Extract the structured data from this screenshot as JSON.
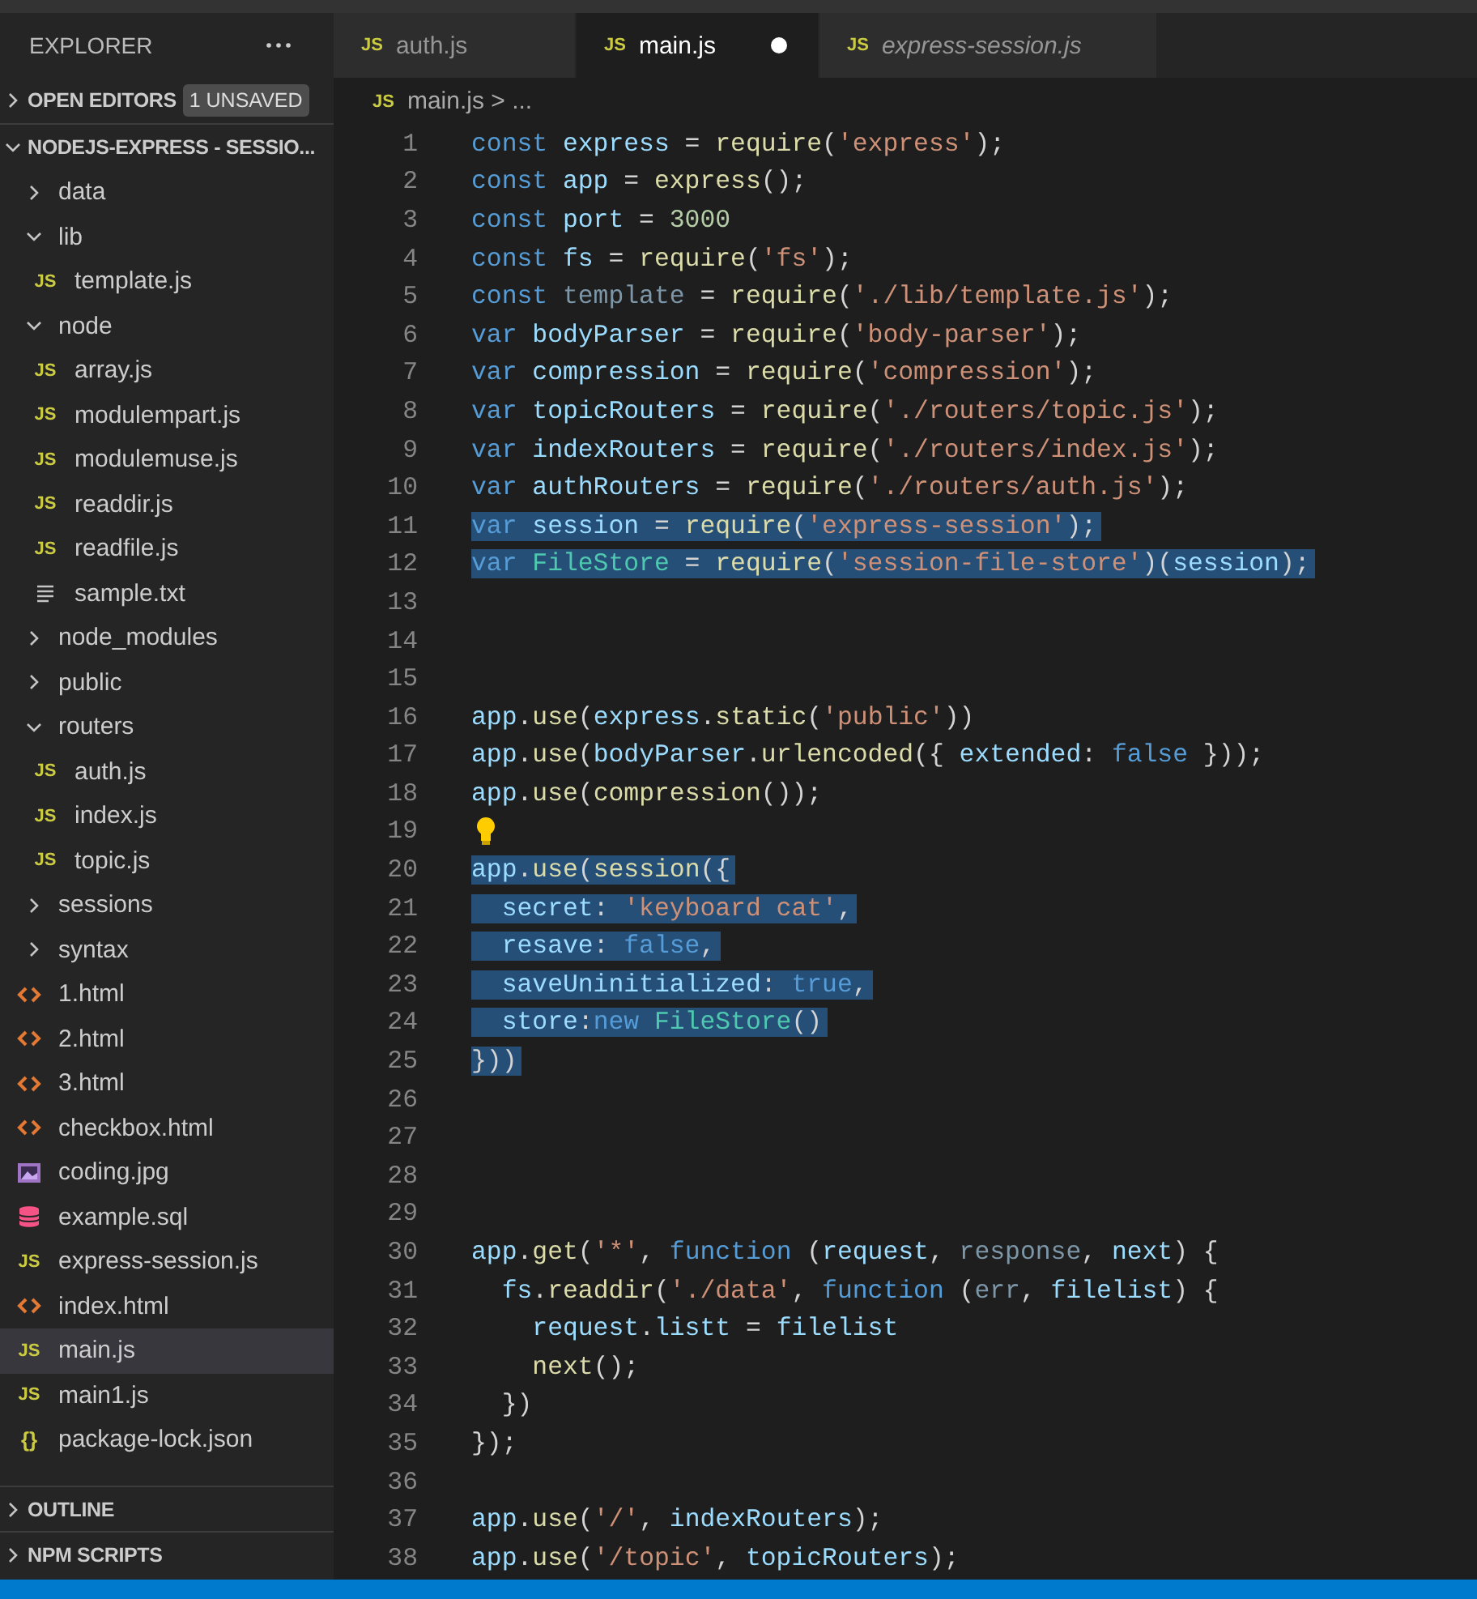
{
  "explorer": {
    "title": "EXPLORER"
  },
  "open_editors": {
    "label": "OPEN EDITORS",
    "badge": "1 UNSAVED",
    "expanded": false
  },
  "folder": {
    "label": "NODEJS-EXPRESS - SESSIO...",
    "expanded": true,
    "items": [
      {
        "label": "data",
        "kind": "folder",
        "expanded": false,
        "selected": false
      },
      {
        "label": "lib",
        "kind": "folder",
        "expanded": true,
        "selected": false,
        "children": [
          {
            "label": "template.js",
            "kind": "js",
            "icon_text": "JS",
            "selected": false
          }
        ]
      },
      {
        "label": "node",
        "kind": "folder",
        "expanded": true,
        "selected": false,
        "children": [
          {
            "label": "array.js",
            "kind": "js",
            "icon_text": "JS",
            "selected": false
          },
          {
            "label": "modulempart.js",
            "kind": "js",
            "icon_text": "JS",
            "selected": false
          },
          {
            "label": "modulemuse.js",
            "kind": "js",
            "icon_text": "JS",
            "selected": false
          },
          {
            "label": "readdir.js",
            "kind": "js",
            "icon_text": "JS",
            "selected": false
          },
          {
            "label": "readfile.js",
            "kind": "js",
            "icon_text": "JS",
            "selected": false
          },
          {
            "label": "sample.txt",
            "kind": "txt",
            "selected": false
          }
        ]
      },
      {
        "label": "node_modules",
        "kind": "folder",
        "expanded": false,
        "selected": false
      },
      {
        "label": "public",
        "kind": "folder",
        "expanded": false,
        "selected": false
      },
      {
        "label": "routers",
        "kind": "folder",
        "expanded": true,
        "selected": false,
        "children": [
          {
            "label": "auth.js",
            "kind": "js",
            "icon_text": "JS",
            "selected": false
          },
          {
            "label": "index.js",
            "kind": "js",
            "icon_text": "JS",
            "selected": false
          },
          {
            "label": "topic.js",
            "kind": "js",
            "icon_text": "JS",
            "selected": false
          }
        ]
      },
      {
        "label": "sessions",
        "kind": "folder",
        "expanded": false,
        "selected": false
      },
      {
        "label": "syntax",
        "kind": "folder",
        "expanded": false,
        "selected": false
      },
      {
        "label": "1.html",
        "kind": "html",
        "selected": false
      },
      {
        "label": "2.html",
        "kind": "html",
        "selected": false
      },
      {
        "label": "3.html",
        "kind": "html",
        "selected": false
      },
      {
        "label": "checkbox.html",
        "kind": "html",
        "selected": false
      },
      {
        "label": "coding.jpg",
        "kind": "image",
        "selected": false
      },
      {
        "label": "example.sql",
        "kind": "db",
        "selected": false
      },
      {
        "label": "express-session.js",
        "kind": "js",
        "icon_text": "JS",
        "selected": false
      },
      {
        "label": "index.html",
        "kind": "html",
        "selected": false
      },
      {
        "label": "main.js",
        "kind": "js",
        "icon_text": "JS",
        "selected": true
      },
      {
        "label": "main1.js",
        "kind": "js",
        "icon_text": "JS",
        "selected": false
      },
      {
        "label": "package-lock.json",
        "kind": "json",
        "icon_text": "{}",
        "selected": false
      }
    ]
  },
  "outline": {
    "label": "OUTLINE",
    "expanded": false
  },
  "npm_scripts": {
    "label": "NPM SCRIPTS",
    "expanded": false
  },
  "tabs": [
    {
      "label": "auth.js",
      "icon_text": "JS",
      "selected": false,
      "modified": false,
      "preview": false
    },
    {
      "label": "main.js",
      "icon_text": "JS",
      "selected": true,
      "modified": true,
      "preview": false
    },
    {
      "label": "express-session.js",
      "icon_text": "JS",
      "selected": false,
      "modified": false,
      "preview": true
    }
  ],
  "breadcrumb": {
    "icon_text": "JS",
    "path": "main.js > ..."
  },
  "lines": [
    {
      "number": "1",
      "selected": false,
      "tokens": [
        {
          "kind": "k",
          "text": "const "
        },
        {
          "kind": "v",
          "text": "express"
        },
        {
          "kind": "p",
          "text": " = "
        },
        {
          "kind": "f",
          "text": "require"
        },
        {
          "kind": "p",
          "text": "("
        },
        {
          "kind": "s",
          "text": "'express'"
        },
        {
          "kind": "p",
          "text": ");"
        }
      ]
    },
    {
      "number": "2",
      "selected": false,
      "tokens": [
        {
          "kind": "k",
          "text": "const "
        },
        {
          "kind": "v",
          "text": "app"
        },
        {
          "kind": "p",
          "text": " = "
        },
        {
          "kind": "f",
          "text": "express"
        },
        {
          "kind": "p",
          "text": "();"
        }
      ]
    },
    {
      "number": "3",
      "selected": false,
      "tokens": [
        {
          "kind": "k",
          "text": "const "
        },
        {
          "kind": "v",
          "text": "port"
        },
        {
          "kind": "p",
          "text": " = "
        },
        {
          "kind": "n",
          "text": "3000"
        }
      ]
    },
    {
      "number": "4",
      "selected": false,
      "tokens": [
        {
          "kind": "k",
          "text": "const "
        },
        {
          "kind": "v",
          "text": "fs"
        },
        {
          "kind": "p",
          "text": " = "
        },
        {
          "kind": "f",
          "text": "require"
        },
        {
          "kind": "p",
          "text": "("
        },
        {
          "kind": "s",
          "text": "'fs'"
        },
        {
          "kind": "p",
          "text": ");"
        }
      ]
    },
    {
      "number": "5",
      "selected": false,
      "tokens": [
        {
          "kind": "k",
          "text": "const "
        },
        {
          "kind": "u",
          "text": "template"
        },
        {
          "kind": "p",
          "text": " = "
        },
        {
          "kind": "f",
          "text": "require"
        },
        {
          "kind": "p",
          "text": "("
        },
        {
          "kind": "s",
          "text": "'./lib/template.js'"
        },
        {
          "kind": "p",
          "text": ");"
        }
      ]
    },
    {
      "number": "6",
      "selected": false,
      "tokens": [
        {
          "kind": "k",
          "text": "var "
        },
        {
          "kind": "v",
          "text": "bodyParser"
        },
        {
          "kind": "p",
          "text": " = "
        },
        {
          "kind": "f",
          "text": "require"
        },
        {
          "kind": "p",
          "text": "("
        },
        {
          "kind": "s",
          "text": "'body-parser'"
        },
        {
          "kind": "p",
          "text": ");"
        }
      ]
    },
    {
      "number": "7",
      "selected": false,
      "tokens": [
        {
          "kind": "k",
          "text": "var "
        },
        {
          "kind": "v",
          "text": "compression"
        },
        {
          "kind": "p",
          "text": " = "
        },
        {
          "kind": "f",
          "text": "require"
        },
        {
          "kind": "p",
          "text": "("
        },
        {
          "kind": "s",
          "text": "'compression'"
        },
        {
          "kind": "p",
          "text": ");"
        }
      ]
    },
    {
      "number": "8",
      "selected": false,
      "tokens": [
        {
          "kind": "k",
          "text": "var "
        },
        {
          "kind": "v",
          "text": "topicRouters"
        },
        {
          "kind": "p",
          "text": " = "
        },
        {
          "kind": "f",
          "text": "require"
        },
        {
          "kind": "p",
          "text": "("
        },
        {
          "kind": "s",
          "text": "'./routers/topic.js'"
        },
        {
          "kind": "p",
          "text": ");"
        }
      ]
    },
    {
      "number": "9",
      "selected": false,
      "tokens": [
        {
          "kind": "k",
          "text": "var "
        },
        {
          "kind": "v",
          "text": "indexRouters"
        },
        {
          "kind": "p",
          "text": " = "
        },
        {
          "kind": "f",
          "text": "require"
        },
        {
          "kind": "p",
          "text": "("
        },
        {
          "kind": "s",
          "text": "'./routers/index.js'"
        },
        {
          "kind": "p",
          "text": ");"
        }
      ]
    },
    {
      "number": "10",
      "selected": false,
      "tokens": [
        {
          "kind": "k",
          "text": "var "
        },
        {
          "kind": "v",
          "text": "authRouters"
        },
        {
          "kind": "p",
          "text": " = "
        },
        {
          "kind": "f",
          "text": "require"
        },
        {
          "kind": "p",
          "text": "("
        },
        {
          "kind": "s",
          "text": "'./routers/auth.js'"
        },
        {
          "kind": "p",
          "text": ");"
        }
      ]
    },
    {
      "number": "11",
      "selected": true,
      "tokens": [
        {
          "kind": "k",
          "text": "var "
        },
        {
          "kind": "v",
          "text": "session"
        },
        {
          "kind": "p",
          "text": " = "
        },
        {
          "kind": "f",
          "text": "require"
        },
        {
          "kind": "p",
          "text": "("
        },
        {
          "kind": "s",
          "text": "'express-session'"
        },
        {
          "kind": "p",
          "text": ");"
        }
      ]
    },
    {
      "number": "12",
      "selected": true,
      "tokens": [
        {
          "kind": "k",
          "text": "var "
        },
        {
          "kind": "c",
          "text": "FileStore"
        },
        {
          "kind": "p",
          "text": " = "
        },
        {
          "kind": "f",
          "text": "require"
        },
        {
          "kind": "p",
          "text": "("
        },
        {
          "kind": "s",
          "text": "'session-file-store'"
        },
        {
          "kind": "p",
          "text": ")("
        },
        {
          "kind": "v",
          "text": "session"
        },
        {
          "kind": "p",
          "text": ");"
        }
      ]
    },
    {
      "number": "13",
      "selected": false
    },
    {
      "number": "14",
      "selected": false
    },
    {
      "number": "15",
      "selected": false
    },
    {
      "number": "16",
      "selected": false,
      "tokens": [
        {
          "kind": "v",
          "text": "app"
        },
        {
          "kind": "p",
          "text": "."
        },
        {
          "kind": "f",
          "text": "use"
        },
        {
          "kind": "p",
          "text": "("
        },
        {
          "kind": "v",
          "text": "express"
        },
        {
          "kind": "p",
          "text": "."
        },
        {
          "kind": "f",
          "text": "static"
        },
        {
          "kind": "p",
          "text": "("
        },
        {
          "kind": "s",
          "text": "'public'"
        },
        {
          "kind": "p",
          "text": "))"
        }
      ]
    },
    {
      "number": "17",
      "selected": false,
      "tokens": [
        {
          "kind": "v",
          "text": "app"
        },
        {
          "kind": "p",
          "text": "."
        },
        {
          "kind": "f",
          "text": "use"
        },
        {
          "kind": "p",
          "text": "("
        },
        {
          "kind": "v",
          "text": "bodyParser"
        },
        {
          "kind": "p",
          "text": "."
        },
        {
          "kind": "f",
          "text": "urlencoded"
        },
        {
          "kind": "p",
          "text": "({ "
        },
        {
          "kind": "v",
          "text": "extended"
        },
        {
          "kind": "p",
          "text": ": "
        },
        {
          "kind": "k",
          "text": "false"
        },
        {
          "kind": "p",
          "text": " }));"
        }
      ]
    },
    {
      "number": "18",
      "selected": false,
      "tokens": [
        {
          "kind": "v",
          "text": "app"
        },
        {
          "kind": "p",
          "text": "."
        },
        {
          "kind": "f",
          "text": "use"
        },
        {
          "kind": "p",
          "text": "("
        },
        {
          "kind": "f",
          "text": "compression"
        },
        {
          "kind": "p",
          "text": "());"
        }
      ]
    },
    {
      "number": "19",
      "selected": false,
      "lightbulb": true
    },
    {
      "number": "20",
      "selected": true,
      "tokens": [
        {
          "kind": "v",
          "text": "app"
        },
        {
          "kind": "p",
          "text": "."
        },
        {
          "kind": "f",
          "text": "use"
        },
        {
          "kind": "p",
          "text": "("
        },
        {
          "kind": "f",
          "text": "session"
        },
        {
          "kind": "p",
          "text": "({"
        }
      ]
    },
    {
      "number": "21",
      "selected": true,
      "tokens": [
        {
          "kind": "v",
          "text": "  secret"
        },
        {
          "kind": "p",
          "text": ": "
        },
        {
          "kind": "s",
          "text": "'keyboard cat'"
        },
        {
          "kind": "p",
          "text": ","
        }
      ]
    },
    {
      "number": "22",
      "selected": true,
      "tokens": [
        {
          "kind": "v",
          "text": "  resave"
        },
        {
          "kind": "p",
          "text": ": "
        },
        {
          "kind": "k",
          "text": "false"
        },
        {
          "kind": "p",
          "text": ","
        }
      ]
    },
    {
      "number": "23",
      "selected": true,
      "tokens": [
        {
          "kind": "v",
          "text": "  saveUninitialized"
        },
        {
          "kind": "p",
          "text": ": "
        },
        {
          "kind": "k",
          "text": "true"
        },
        {
          "kind": "p",
          "text": ","
        }
      ]
    },
    {
      "number": "24",
      "selected": true,
      "tokens": [
        {
          "kind": "v",
          "text": "  store"
        },
        {
          "kind": "p",
          "text": ":"
        },
        {
          "kind": "k",
          "text": "new "
        },
        {
          "kind": "c",
          "text": "FileStore"
        },
        {
          "kind": "p",
          "text": "()"
        }
      ]
    },
    {
      "number": "25",
      "selected": true,
      "tokens": [
        {
          "kind": "p",
          "text": "}))"
        }
      ]
    },
    {
      "number": "26",
      "selected": false
    },
    {
      "number": "27",
      "selected": false
    },
    {
      "number": "28",
      "selected": false
    },
    {
      "number": "29",
      "selected": false
    },
    {
      "number": "30",
      "selected": false,
      "tokens": [
        {
          "kind": "v",
          "text": "app"
        },
        {
          "kind": "p",
          "text": "."
        },
        {
          "kind": "f",
          "text": "get"
        },
        {
          "kind": "p",
          "text": "("
        },
        {
          "kind": "s",
          "text": "'*'"
        },
        {
          "kind": "p",
          "text": ", "
        },
        {
          "kind": "k",
          "text": "function"
        },
        {
          "kind": "p",
          "text": " ("
        },
        {
          "kind": "v",
          "text": "request"
        },
        {
          "kind": "p",
          "text": ", "
        },
        {
          "kind": "u",
          "text": "response"
        },
        {
          "kind": "p",
          "text": ", "
        },
        {
          "kind": "v",
          "text": "next"
        },
        {
          "kind": "p",
          "text": ") {"
        }
      ]
    },
    {
      "number": "31",
      "selected": false,
      "tokens": [
        {
          "kind": "v",
          "text": "  fs"
        },
        {
          "kind": "p",
          "text": "."
        },
        {
          "kind": "f",
          "text": "readdir"
        },
        {
          "kind": "p",
          "text": "("
        },
        {
          "kind": "s",
          "text": "'./data'"
        },
        {
          "kind": "p",
          "text": ", "
        },
        {
          "kind": "k",
          "text": "function"
        },
        {
          "kind": "p",
          "text": " ("
        },
        {
          "kind": "u",
          "text": "err"
        },
        {
          "kind": "p",
          "text": ", "
        },
        {
          "kind": "v",
          "text": "filelist"
        },
        {
          "kind": "p",
          "text": ") {"
        }
      ]
    },
    {
      "number": "32",
      "selected": false,
      "tokens": [
        {
          "kind": "v",
          "text": "    request"
        },
        {
          "kind": "p",
          "text": "."
        },
        {
          "kind": "v",
          "text": "listt"
        },
        {
          "kind": "p",
          "text": " = "
        },
        {
          "kind": "v",
          "text": "filelist"
        }
      ]
    },
    {
      "number": "33",
      "selected": false,
      "tokens": [
        {
          "kind": "f",
          "text": "    next"
        },
        {
          "kind": "p",
          "text": "();"
        }
      ]
    },
    {
      "number": "34",
      "selected": false,
      "tokens": [
        {
          "kind": "p",
          "text": "  })"
        }
      ]
    },
    {
      "number": "35",
      "selected": false,
      "tokens": [
        {
          "kind": "p",
          "text": "});"
        }
      ]
    },
    {
      "number": "36",
      "selected": false
    },
    {
      "number": "37",
      "selected": false,
      "tokens": [
        {
          "kind": "v",
          "text": "app"
        },
        {
          "kind": "p",
          "text": "."
        },
        {
          "kind": "f",
          "text": "use"
        },
        {
          "kind": "p",
          "text": "("
        },
        {
          "kind": "s",
          "text": "'/'"
        },
        {
          "kind": "p",
          "text": ", "
        },
        {
          "kind": "v",
          "text": "indexRouters"
        },
        {
          "kind": "p",
          "text": ");"
        }
      ]
    },
    {
      "number": "38",
      "selected": false,
      "tokens": [
        {
          "kind": "v",
          "text": "app"
        },
        {
          "kind": "p",
          "text": "."
        },
        {
          "kind": "f",
          "text": "use"
        },
        {
          "kind": "p",
          "text": "("
        },
        {
          "kind": "s",
          "text": "'/topic'"
        },
        {
          "kind": "p",
          "text": ", "
        },
        {
          "kind": "v",
          "text": "topicRouters"
        },
        {
          "kind": "p",
          "text": ");"
        }
      ]
    }
  ]
}
